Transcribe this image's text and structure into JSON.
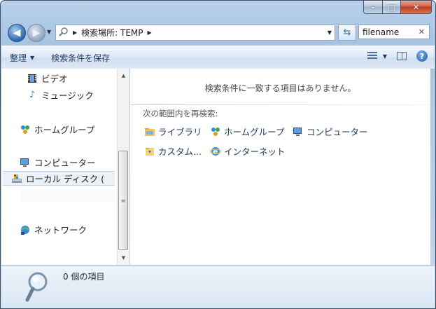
{
  "window": {
    "caption_buttons": {
      "minimize": "–",
      "maximize": "□",
      "close": "✕"
    }
  },
  "address": {
    "path_prefix": "検索場所: TEMP",
    "search_value": "filename"
  },
  "toolbar": {
    "organize": "整理",
    "save_search": "検索条件を保存"
  },
  "nav": {
    "items": [
      {
        "label": "ビデオ",
        "icon": "video-icon"
      },
      {
        "label": "ミュージック",
        "icon": "music-icon"
      },
      {
        "label": "ホームグループ",
        "icon": "homegroup-icon"
      },
      {
        "label": "コンピューター",
        "icon": "computer-icon"
      },
      {
        "label": "ローカル ディスク (",
        "icon": "drive-icon"
      },
      {
        "label": "ネットワーク",
        "icon": "network-icon"
      }
    ]
  },
  "content": {
    "no_results": "検索条件に一致する項目はありません。",
    "search_again": "次の範囲内を再検索:",
    "options": [
      {
        "label": "ライブラリ",
        "icon": "library-icon"
      },
      {
        "label": "ホームグループ",
        "icon": "homegroup-icon"
      },
      {
        "label": "コンピューター",
        "icon": "computer-icon"
      },
      {
        "label": "カスタム...",
        "icon": "custom-folder-icon"
      },
      {
        "label": "インターネット",
        "icon": "internet-icon"
      }
    ]
  },
  "status": {
    "count_text": "0 個の項目"
  }
}
